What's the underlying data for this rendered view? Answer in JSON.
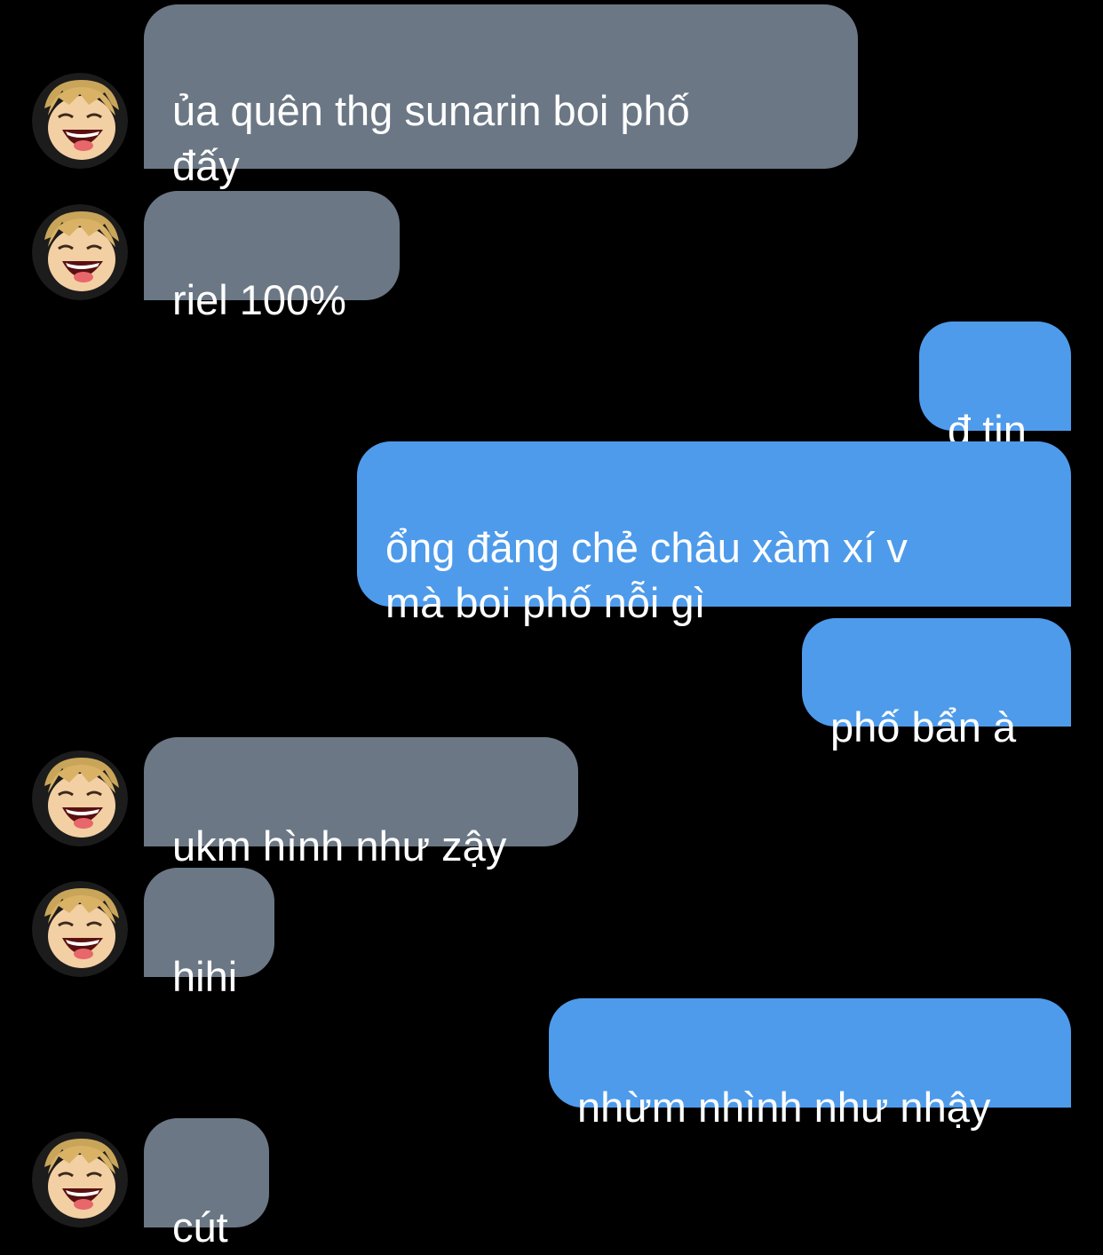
{
  "messages": [
    {
      "side": "incoming",
      "text": "ủa quên thg sunarin boi phố\nđấy"
    },
    {
      "side": "incoming",
      "text": "riel 100%"
    },
    {
      "side": "outgoing",
      "text": "đ tin"
    },
    {
      "side": "outgoing",
      "text": "ổng đăng chẻ châu xàm xí v\nmà boi phố nỗi gì"
    },
    {
      "side": "outgoing",
      "text": "phố bẩn à"
    },
    {
      "side": "incoming",
      "text": "ukm hình như zậy"
    },
    {
      "side": "incoming",
      "text": "hihi"
    },
    {
      "side": "outgoing",
      "text": "nhừm nhình như nhậy"
    },
    {
      "side": "incoming",
      "text": "cút"
    }
  ],
  "colors": {
    "background": "#000000",
    "incoming_bubble": "#6b7784",
    "outgoing_bubble": "#4e9beb",
    "text": "#ffffff"
  },
  "avatar_icon": "anime-laughing-face-avatar"
}
